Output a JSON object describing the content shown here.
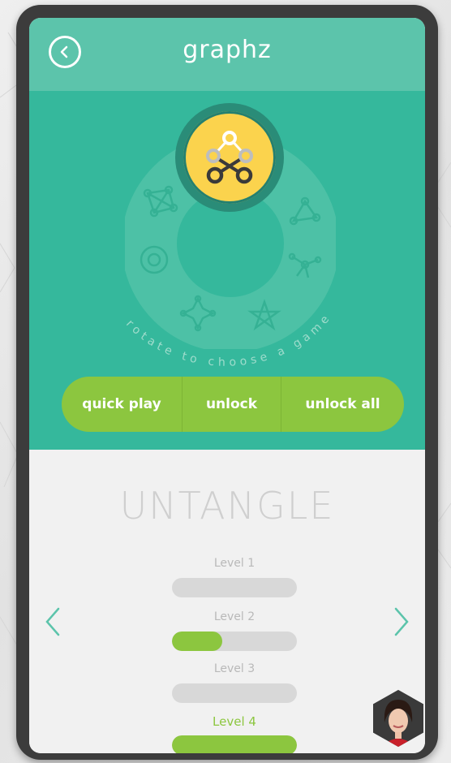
{
  "header": {
    "app_title": "graphz",
    "back_icon": "chevron-left-circle-icon"
  },
  "game_selector": {
    "hint": "rotate to choose a game",
    "selected_game_icon": "graph-nodes-icon",
    "wheel_icons": [
      "graph-nodes-icon",
      "triangle-graph-icon",
      "star-graph-icon",
      "pentagram-graph-icon",
      "hex-star-graph-icon",
      "ring-graph-icon",
      "mesh-graph-icon"
    ]
  },
  "actions": {
    "quick_play": "quick play",
    "unlock": "unlock",
    "unlock_all": "unlock all"
  },
  "game": {
    "name": "UNTANGLE",
    "levels": [
      {
        "label": "Level 1",
        "progress": 0,
        "active": false
      },
      {
        "label": "Level 2",
        "progress": 0.4,
        "active": false
      },
      {
        "label": "Level 3",
        "progress": 0,
        "active": false
      },
      {
        "label": "Level 4",
        "progress": 1.0,
        "active": true
      }
    ]
  },
  "colors": {
    "topbar": "#5cc4ab",
    "panel": "#35b89c",
    "accent_green": "#8cc63f",
    "badge_yellow": "#fbd34d"
  }
}
